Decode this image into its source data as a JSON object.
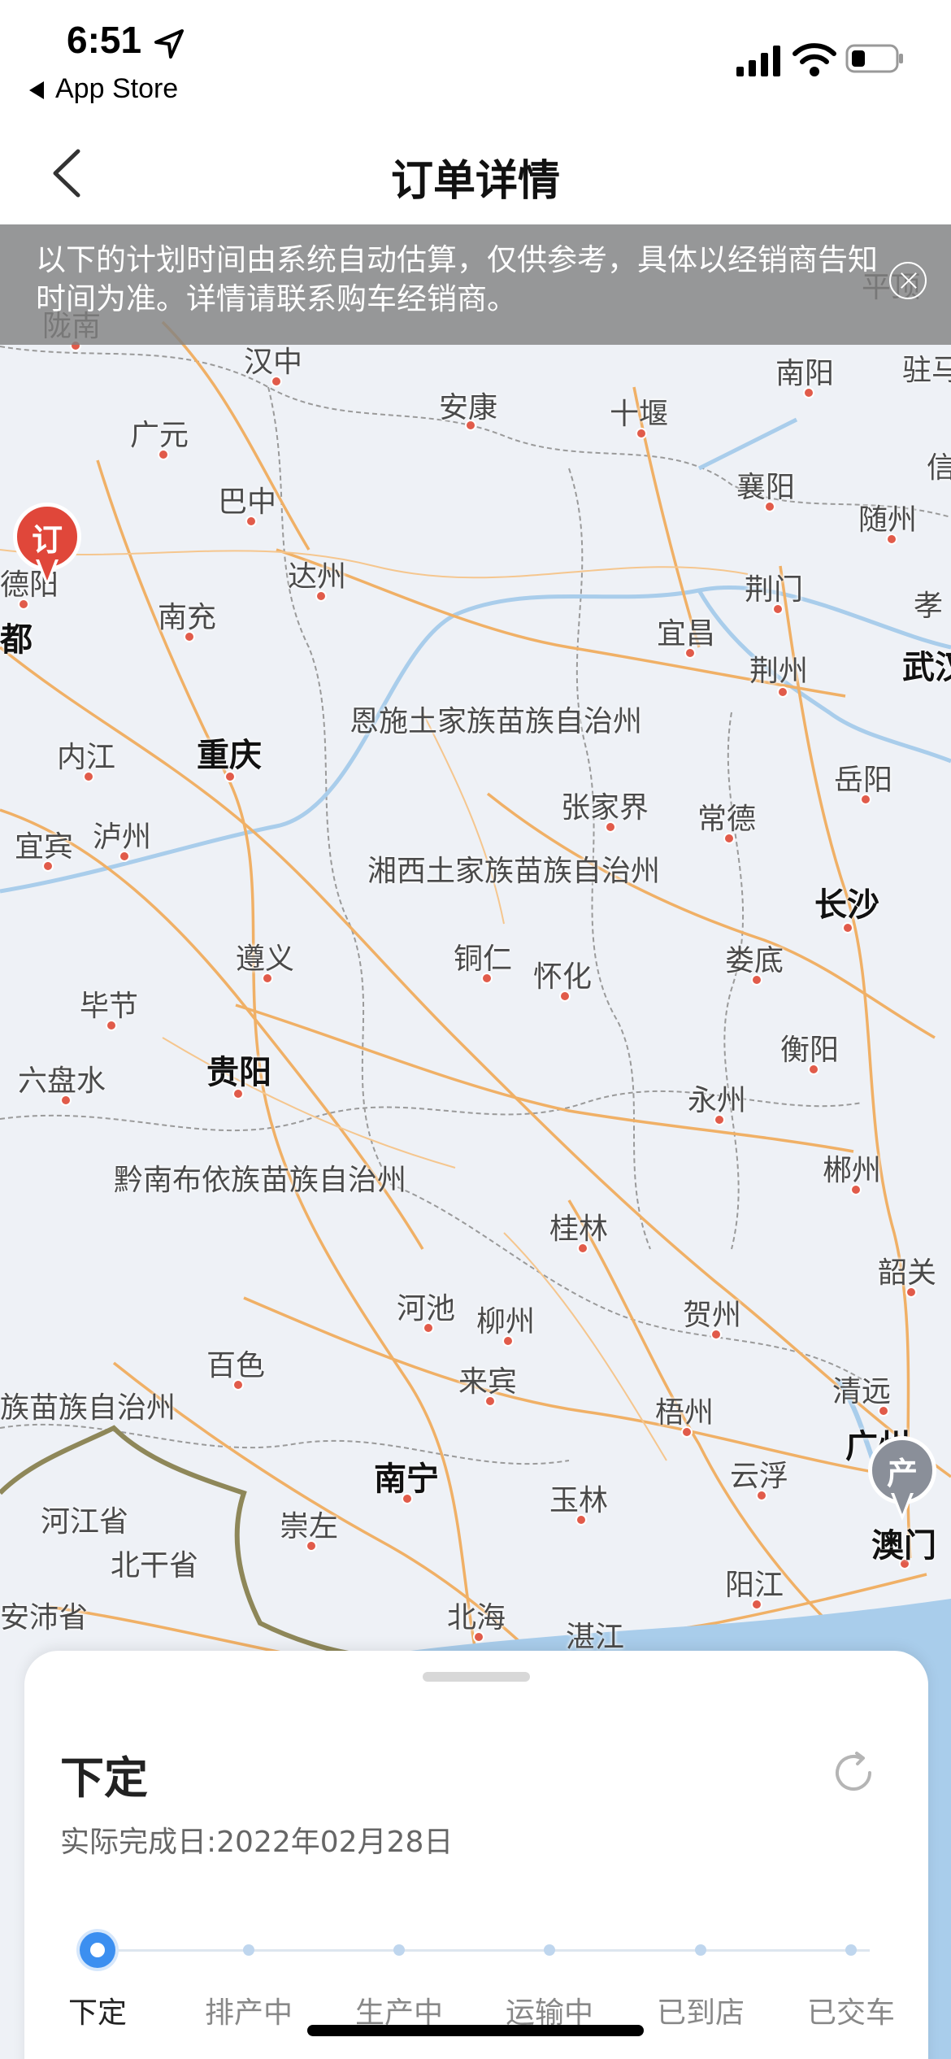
{
  "status_bar": {
    "time": "6:51",
    "back_app": "App Store"
  },
  "nav": {
    "title": "订单详情"
  },
  "notice": {
    "text": "以下的计划时间由系统自动估算，仅供参考，具体以经销商告知时间为准。详情请联系购车经销商。"
  },
  "map": {
    "cities": [
      {
        "name": "汉中",
        "big": false
      },
      {
        "name": "广元",
        "big": false
      },
      {
        "name": "安康",
        "big": false
      },
      {
        "name": "十堰",
        "big": false
      },
      {
        "name": "南阳",
        "big": false
      },
      {
        "name": "驻马",
        "big": false
      },
      {
        "name": "巴中",
        "big": false
      },
      {
        "name": "襄阳",
        "big": false
      },
      {
        "name": "随州",
        "big": false
      },
      {
        "name": "达州",
        "big": false
      },
      {
        "name": "南充",
        "big": false
      },
      {
        "name": "荆门",
        "big": false
      },
      {
        "name": "宜昌",
        "big": false
      },
      {
        "name": "荆州",
        "big": false
      },
      {
        "name": "武汉",
        "big": true
      },
      {
        "name": "孝",
        "big": false
      },
      {
        "name": "恩施土家族苗族自治州",
        "big": false
      },
      {
        "name": "内江",
        "big": false
      },
      {
        "name": "重庆",
        "big": true
      },
      {
        "name": "张家界",
        "big": false
      },
      {
        "name": "常德",
        "big": false
      },
      {
        "name": "岳阳",
        "big": false
      },
      {
        "name": "宜宾",
        "big": false
      },
      {
        "name": "泸州",
        "big": false
      },
      {
        "name": "湘西土家族苗族自治州",
        "big": false
      },
      {
        "name": "长沙",
        "big": true
      },
      {
        "name": "遵义",
        "big": false
      },
      {
        "name": "铜仁",
        "big": false
      },
      {
        "name": "怀化",
        "big": false
      },
      {
        "name": "娄底",
        "big": false
      },
      {
        "name": "毕节",
        "big": false
      },
      {
        "name": "衡阳",
        "big": false
      },
      {
        "name": "贵阳",
        "big": true
      },
      {
        "name": "六盘水",
        "big": false
      },
      {
        "name": "永州",
        "big": false
      },
      {
        "name": "黔南布依族苗族自治州",
        "big": false
      },
      {
        "name": "郴州",
        "big": false
      },
      {
        "name": "桂林",
        "big": false
      },
      {
        "name": "韶关",
        "big": false
      },
      {
        "name": "河池",
        "big": false
      },
      {
        "name": "柳州",
        "big": false
      },
      {
        "name": "贺州",
        "big": false
      },
      {
        "name": "百色",
        "big": false
      },
      {
        "name": "来宾",
        "big": false
      },
      {
        "name": "清远",
        "big": false
      },
      {
        "name": "族苗族自治州",
        "big": false
      },
      {
        "name": "梧州",
        "big": false
      },
      {
        "name": "广州",
        "big": true
      },
      {
        "name": "南宁",
        "big": true
      },
      {
        "name": "玉林",
        "big": false
      },
      {
        "name": "云浮",
        "big": false
      },
      {
        "name": "河江省",
        "big": false
      },
      {
        "name": "崇左",
        "big": false
      },
      {
        "name": "澳门",
        "big": true
      },
      {
        "name": "北干省",
        "big": false
      },
      {
        "name": "阳江",
        "big": false
      },
      {
        "name": "安沛省",
        "big": false
      },
      {
        "name": "北海",
        "big": false
      },
      {
        "name": "湛江",
        "big": false
      },
      {
        "name": "陇南",
        "big": false
      },
      {
        "name": "德阳",
        "big": false
      },
      {
        "name": "都",
        "big": true
      },
      {
        "name": "平顶",
        "big": false
      },
      {
        "name": "信",
        "big": false
      }
    ],
    "order_pin": "订",
    "production_pin": "产",
    "order_pin_color": "#e0473a",
    "production_pin_color": "#8a8f99"
  },
  "sheet": {
    "title": "下定",
    "date_text": "实际完成日:2022年02月28日",
    "steps": [
      {
        "label": "下定",
        "active": true
      },
      {
        "label": "排产中",
        "active": false
      },
      {
        "label": "生产中",
        "active": false
      },
      {
        "label": "运输中",
        "active": false
      },
      {
        "label": "已到店",
        "active": false
      },
      {
        "label": "已交车",
        "active": false
      }
    ]
  },
  "colors": {
    "accent": "#3c8ff0",
    "road": "#f0b066",
    "water": "#a9cdeb",
    "border": "#8e8759"
  }
}
